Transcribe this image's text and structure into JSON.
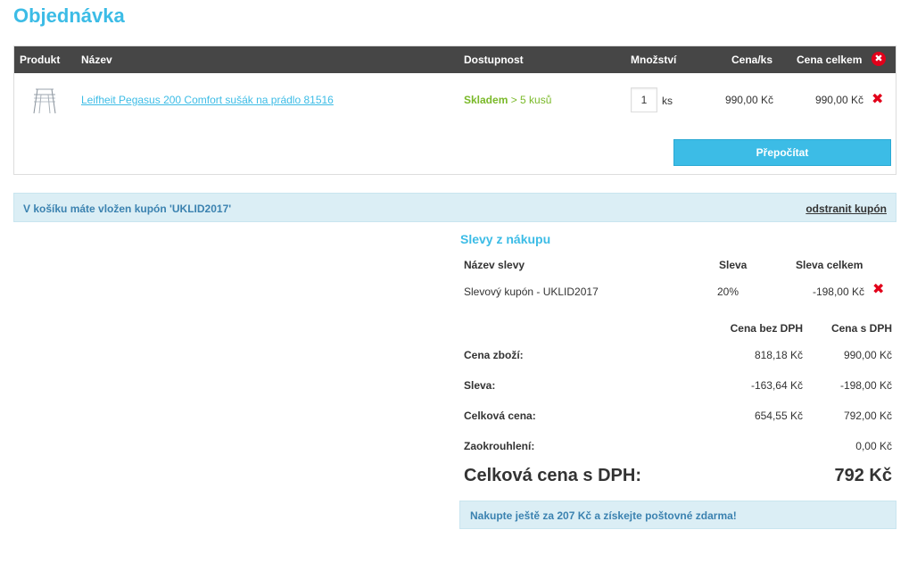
{
  "page": {
    "title": "Objednávka"
  },
  "cart": {
    "headers": {
      "product": "Produkt",
      "name": "Název",
      "availability": "Dostupnost",
      "quantity": "Množství",
      "unit_price": "Cena/ks",
      "total_price": "Cena celkem"
    },
    "items": [
      {
        "name": "Leifheit Pegasus 200 Comfort sušák na prádlo 81516",
        "stock_status": "Skladem",
        "stock_count": "> 5 kusů",
        "quantity": "1",
        "unit": "ks",
        "unit_price": "990,00 Kč",
        "total_price": "990,00 Kč"
      }
    ],
    "recalculate_label": "Přepočítat"
  },
  "coupon": {
    "text": "V košíku máte vložen kupón 'UKLID2017'",
    "remove_label": "odstranit kupón"
  },
  "discounts": {
    "title": "Slevy z nákupu",
    "headers": {
      "name": "Název slevy",
      "discount": "Sleva",
      "total": "Sleva celkem"
    },
    "items": [
      {
        "name": "Slevový kupón - UKLID2017",
        "percent": "20%",
        "amount": "-198,00 Kč"
      }
    ]
  },
  "summary": {
    "headers": {
      "without_vat": "Cena bez DPH",
      "with_vat": "Cena s DPH"
    },
    "rows": [
      {
        "label": "Cena zboží:",
        "without_vat": "818,18 Kč",
        "with_vat": "990,00 Kč"
      },
      {
        "label": "Sleva:",
        "without_vat": "-163,64 Kč",
        "with_vat": "-198,00 Kč"
      },
      {
        "label": "Celková cena:",
        "without_vat": "654,55 Kč",
        "with_vat": "792,00 Kč"
      },
      {
        "label": "Zaokrouhlení:",
        "without_vat": "",
        "with_vat": "0,00 Kč"
      }
    ],
    "grand_total_label": "Celková cena s DPH:",
    "grand_total_value": "792 Kč"
  },
  "shipping_notice": "Nakupte ještě za 207 Kč a získejte poštovné zdarma!",
  "colors": {
    "accent": "#3cbce6",
    "header_bg": "#464646",
    "remove": "#e2001a",
    "stock": "#7ab929",
    "info_bg": "#dbeef5"
  }
}
